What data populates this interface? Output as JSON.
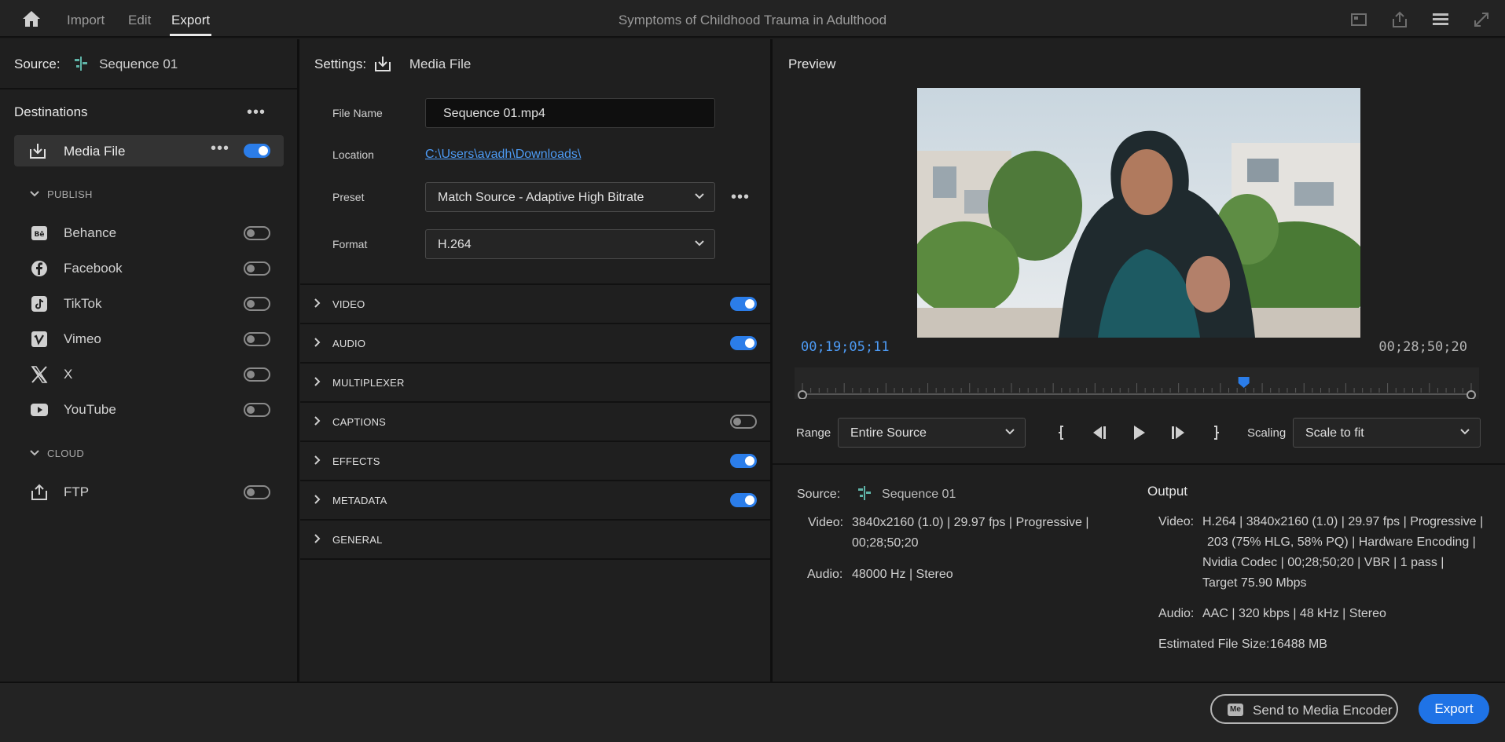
{
  "topbar": {
    "tabs": [
      "Import",
      "Edit",
      "Export"
    ],
    "active_tab": "Export",
    "title": "Symptoms of Childhood Trauma in Adulthood"
  },
  "left": {
    "source_label": "Source:",
    "source_value": "Sequence 01",
    "destinations_title": "Destinations",
    "media_file": {
      "label": "Media File",
      "enabled": true
    },
    "publish_header": "PUBLISH",
    "publish_items": [
      {
        "name": "Behance",
        "icon": "behance-icon",
        "enabled": false
      },
      {
        "name": "Facebook",
        "icon": "facebook-icon",
        "enabled": false
      },
      {
        "name": "TikTok",
        "icon": "tiktok-icon",
        "enabled": false
      },
      {
        "name": "Vimeo",
        "icon": "vimeo-icon",
        "enabled": false
      },
      {
        "name": "X",
        "icon": "x-icon",
        "enabled": false
      },
      {
        "name": "YouTube",
        "icon": "youtube-icon",
        "enabled": false
      }
    ],
    "cloud_header": "CLOUD",
    "cloud_items": [
      {
        "name": "FTP",
        "icon": "upload-icon",
        "enabled": false
      }
    ]
  },
  "settings": {
    "label": "Settings:",
    "target": "Media File",
    "file_name_label": "File Name",
    "file_name_value": "Sequence 01.mp4",
    "location_label": "Location",
    "location_value": "C:\\Users\\avadh\\Downloads\\",
    "preset_label": "Preset",
    "preset_value": "Match Source - Adaptive High Bitrate",
    "format_label": "Format",
    "format_value": "H.264",
    "sections": [
      {
        "label": "VIDEO",
        "toggle": "on"
      },
      {
        "label": "AUDIO",
        "toggle": "on"
      },
      {
        "label": "MULTIPLEXER",
        "toggle": "none"
      },
      {
        "label": "CAPTIONS",
        "toggle": "off"
      },
      {
        "label": "EFFECTS",
        "toggle": "on"
      },
      {
        "label": "METADATA",
        "toggle": "on"
      },
      {
        "label": "GENERAL",
        "toggle": "none"
      }
    ]
  },
  "preview": {
    "title": "Preview",
    "current_timecode": "00;19;05;11",
    "duration_timecode": "00;28;50;20",
    "playhead_fraction": 0.66,
    "range_label": "Range",
    "range_value": "Entire Source",
    "scaling_label": "Scaling",
    "scaling_value": "Scale to fit"
  },
  "source_info": {
    "label": "Source:",
    "value": "Sequence 01",
    "video_label": "Video:",
    "video_line1": "3840x2160 (1.0)  |  29.97 fps  |  Progressive  |",
    "video_line2": "00;28;50;20",
    "audio_label": "Audio:",
    "audio_value": "48000 Hz  |  Stereo"
  },
  "output_info": {
    "title": "Output",
    "video_label": "Video:",
    "video_line1": "H.264  |  3840x2160 (1.0)  |  29.97 fps  |  Progressive  |",
    "video_line2": "203 (75% HLG, 58% PQ)  |  Hardware Encoding  |",
    "video_line3": "Nvidia Codec  |  00;28;50;20   |  VBR  |  1 pass  |",
    "video_line4": "Target 75.90 Mbps",
    "audio_label": "Audio:",
    "audio_value": "AAC  |  320 kbps  |  48 kHz  |  Stereo",
    "size_label": "Estimated File Size:",
    "size_value": "16488 MB"
  },
  "footer": {
    "media_encoder_icon": "Me",
    "send_label": "Send to Media Encoder",
    "export_label": "Export"
  },
  "colors": {
    "accent": "#2b7de9",
    "link": "#4d9bf5",
    "background": "#1d1d1d"
  }
}
